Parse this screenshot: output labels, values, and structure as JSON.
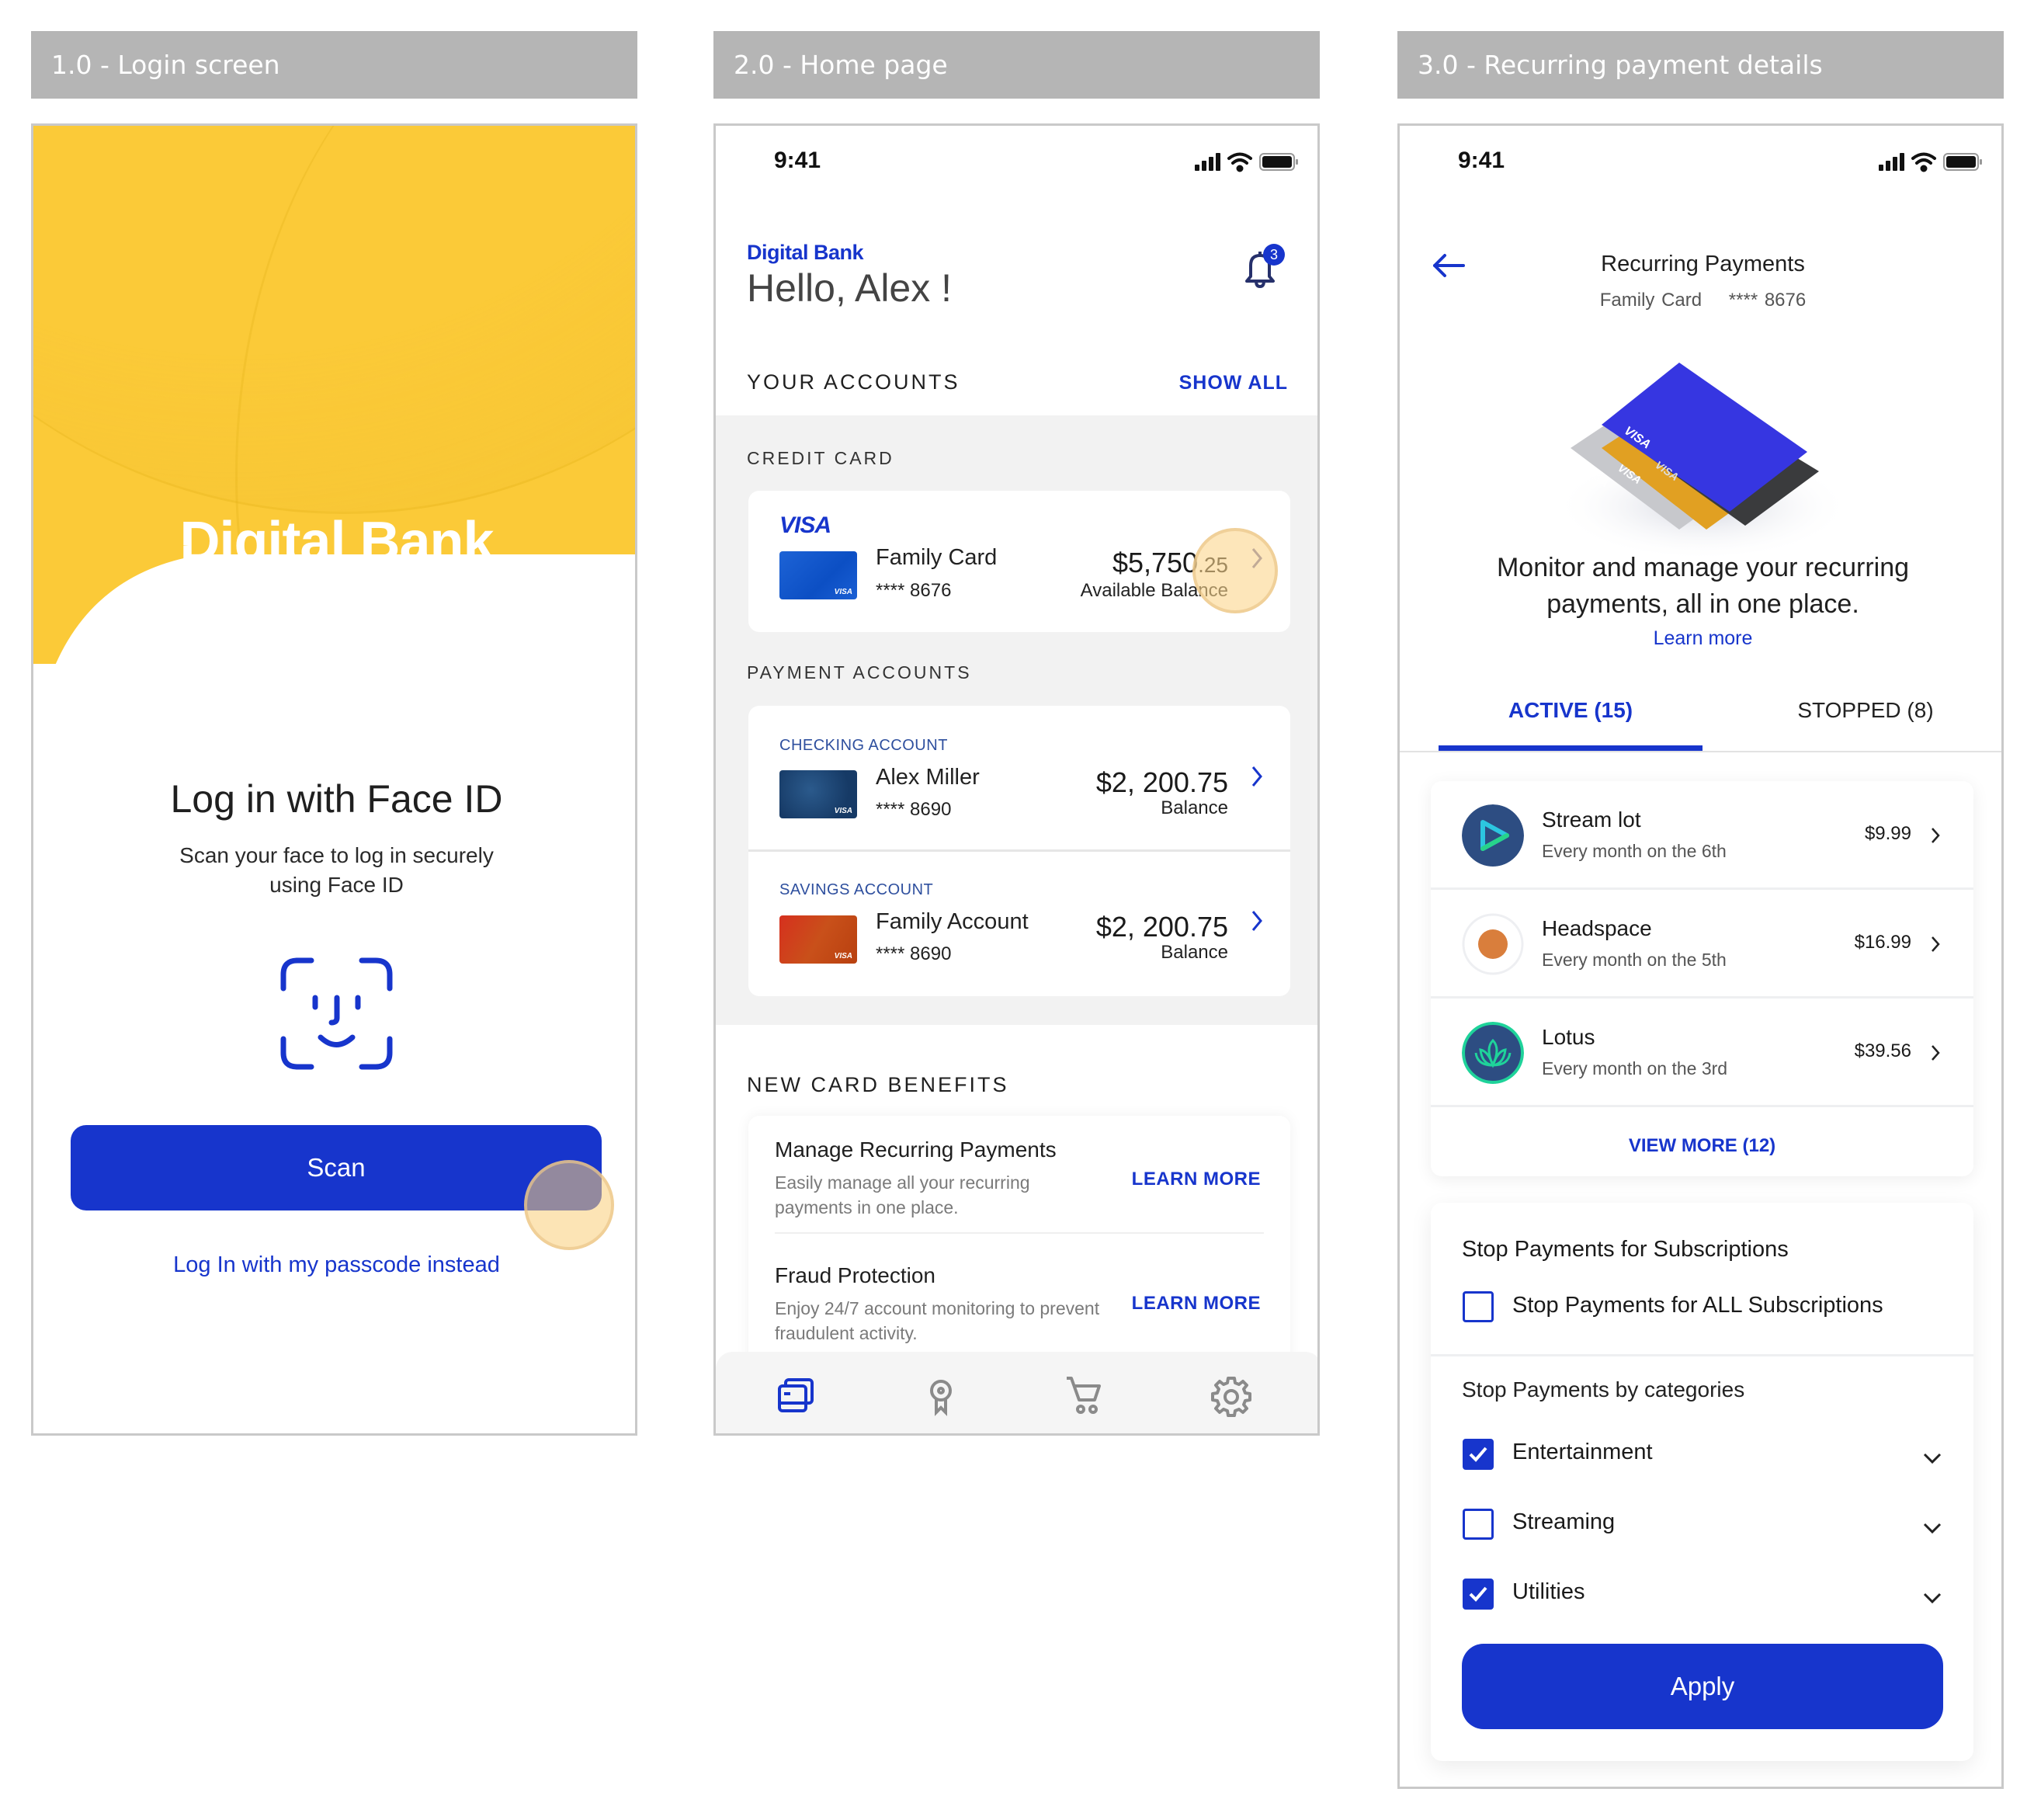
{
  "panels": [
    {
      "header": "1.0 - Login screen"
    },
    {
      "header": "2.0 - Home page"
    },
    {
      "header": "3.0 - Recurring payment details"
    }
  ],
  "login": {
    "brand": "Digital Bank",
    "title": "Log in with Face ID",
    "subtitle_line1": "Scan your face to log in securely",
    "subtitle_line2": "using Face ID",
    "scan_button": "Scan",
    "passcode_link": "Log In with my passcode instead",
    "accent_color": "#1735cc",
    "brand_color": "#fbca38"
  },
  "status_bar": {
    "time": "9:41"
  },
  "home": {
    "brand": "Digital Bank",
    "greeting": "Hello, Alex !",
    "notification_count": "3",
    "accounts_title": "YOUR ACCOUNTS",
    "show_all": "SHOW ALL",
    "credit_card_section": "CREDIT CARD",
    "credit_card": {
      "brand": "VISA",
      "name": "Family Card",
      "number": "**** 8676",
      "amount_main": "$5,750",
      "amount_cents": ".25",
      "amount_label": "Available Balance"
    },
    "payment_section": "PAYMENT ACCOUNTS",
    "payment_accounts": [
      {
        "type": "CHECKING ACCOUNT",
        "name": "Alex Miller",
        "number": "**** 8690",
        "amount": "$2, 200.75",
        "amount_label": "Balance"
      },
      {
        "type": "SAVINGS ACCOUNT",
        "name": "Family Account",
        "number": "**** 8690",
        "amount": "$2, 200.75",
        "amount_label": "Balance"
      }
    ],
    "benefits_title": "NEW CARD BENEFITS",
    "benefits": [
      {
        "title": "Manage Recurring Payments",
        "desc": "Easily manage all your recurring payments in one place.",
        "action": "LEARN MORE"
      },
      {
        "title": "Fraud Protection",
        "desc": "Enjoy 24/7 account monitoring  to prevent  fraudulent activity.",
        "action": "LEARN MORE"
      }
    ],
    "nav": [
      {
        "icon": "cards-icon",
        "active": true
      },
      {
        "icon": "rewards-icon",
        "active": false
      },
      {
        "icon": "cart-icon",
        "active": false
      },
      {
        "icon": "settings-icon",
        "active": false
      }
    ]
  },
  "recurring": {
    "title": "Recurring Payments",
    "card_name": "Family Card",
    "card_number": "**** 8676",
    "card_brand": "VISA",
    "tagline_line1": "Monitor and manage your recurring",
    "tagline_line2": "payments, all in one place.",
    "learn_more": "Learn more",
    "tabs": [
      {
        "label": "ACTIVE (15)",
        "active": true
      },
      {
        "label": "STOPPED (8)",
        "active": false
      }
    ],
    "subscriptions": [
      {
        "name": "Stream lot",
        "schedule": "Every month on the 6th",
        "price": "$9.99",
        "icon": "play-icon"
      },
      {
        "name": "Headspace",
        "schedule": "Every month on the 5th",
        "price": "$16.99",
        "icon": "orange-dot-icon"
      },
      {
        "name": "Lotus",
        "schedule": "Every month on the 3rd",
        "price": "$39.56",
        "icon": "lotus-icon"
      }
    ],
    "view_more": "VIEW MORE (12)",
    "stop_title": "Stop Payments for Subscriptions",
    "stop_all": {
      "label": "Stop Payments for ALL Subscriptions",
      "checked": false
    },
    "categories_title": "Stop Payments by categories",
    "categories": [
      {
        "label": "Entertainment",
        "checked": true
      },
      {
        "label": "Streaming",
        "checked": false
      },
      {
        "label": "Utilities",
        "checked": true
      }
    ],
    "apply_button": "Apply"
  }
}
